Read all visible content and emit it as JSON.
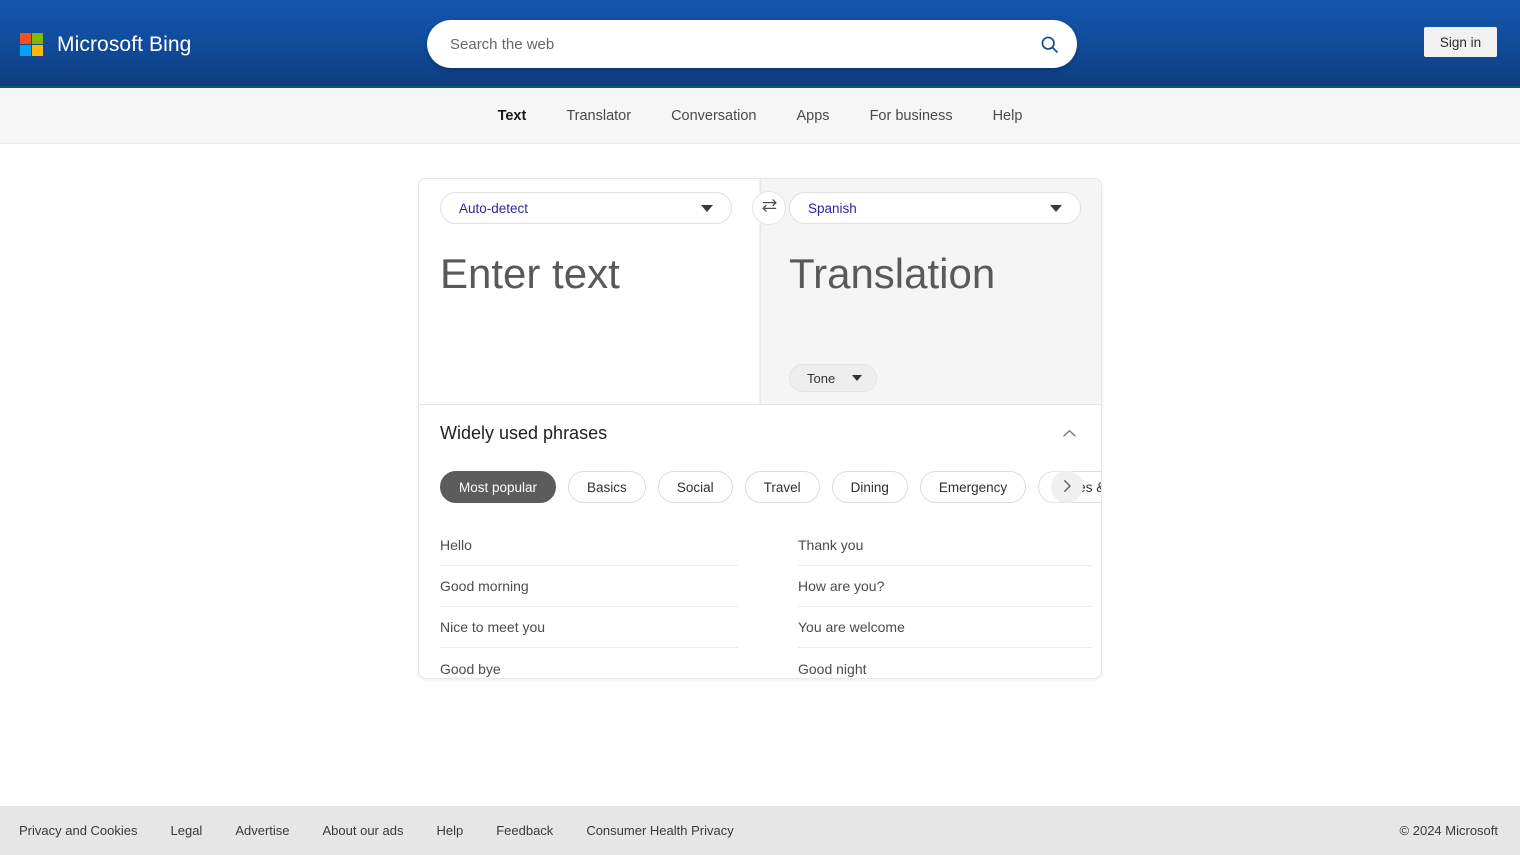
{
  "header": {
    "brand_name": "Microsoft Bing",
    "logo_icon": "microsoft-logo",
    "search": {
      "placeholder": "Search the web",
      "value": "",
      "search_icon": "search-icon"
    },
    "signin_label": "Sign in"
  },
  "nav": {
    "items": [
      {
        "label": "Text",
        "active": true
      },
      {
        "label": "Translator",
        "active": false
      },
      {
        "label": "Conversation",
        "active": false
      },
      {
        "label": "Apps",
        "active": false
      },
      {
        "label": "For business",
        "active": false
      },
      {
        "label": "Help",
        "active": false
      }
    ]
  },
  "translator": {
    "source": {
      "language": "Auto-detect",
      "placeholder": "Enter text",
      "caret_icon": "chevron-down-icon"
    },
    "target": {
      "language": "Spanish",
      "placeholder": "Translation",
      "caret_icon": "chevron-down-icon",
      "tone_label": "Tone",
      "tone_caret_icon": "chevron-down-icon"
    },
    "swap_icon": "swap-languages-icon"
  },
  "phrases": {
    "title": "Widely used phrases",
    "collapse_icon": "chevron-up-icon",
    "next_icon": "chevron-right-icon",
    "categories": [
      {
        "label": "Most popular",
        "selected": true
      },
      {
        "label": "Basics",
        "selected": false
      },
      {
        "label": "Social",
        "selected": false
      },
      {
        "label": "Travel",
        "selected": false
      },
      {
        "label": "Dining",
        "selected": false
      },
      {
        "label": "Emergency",
        "selected": false
      },
      {
        "label": "Dates & numbers",
        "selected": false
      }
    ],
    "left_column": [
      "Hello",
      "Good morning",
      "Nice to meet you",
      "Good bye"
    ],
    "right_column": [
      "Thank you",
      "How are you?",
      "You are welcome",
      "Good night"
    ]
  },
  "footer": {
    "links": [
      "Privacy and Cookies",
      "Legal",
      "Advertise",
      "About our ads",
      "Help",
      "Feedback",
      "Consumer Health Privacy"
    ],
    "copyright": "© 2024 Microsoft"
  },
  "colors": {
    "header_blue_top": "#1455ad",
    "header_blue_bottom": "#0e3d7e",
    "accent_teal": "#0d5c63",
    "lang_text": "#2d25a0",
    "chip_selected_bg": "#5c5c5c",
    "nav_bg": "#f6f6f6",
    "target_pane_bg": "#f5f5f5",
    "footer_bg": "#e6e6e6"
  }
}
